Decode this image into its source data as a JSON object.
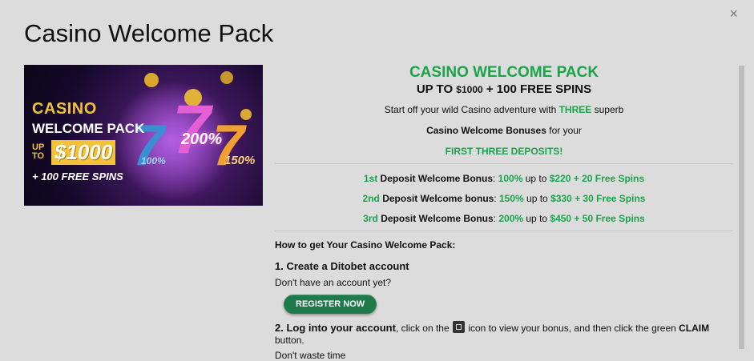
{
  "modal": {
    "title": "Casino Welcome Pack",
    "close_label": "×"
  },
  "banner": {
    "line1": "CASINO",
    "line2": "WELCOME PACK",
    "upto": "UP TO",
    "amount": "$1000",
    "spins": "+ 100 FREE SPINS",
    "pct_left": "100%",
    "pct_mid": "200%",
    "pct_right": "150%"
  },
  "content": {
    "heading": "CASINO WELCOME PACK",
    "sub_prefix": "UP TO ",
    "sub_amount": "$1000",
    "sub_suffix": " + 100 FREE SPINS",
    "intro_a": "Start off your wild Casino adventure with ",
    "intro_three": "THREE",
    "intro_b": " superb",
    "intro2_bold": "Casino Welcome Bonuses",
    "intro2_rest": " for your",
    "intro3": "FIRST THREE DEPOSITS",
    "intro3_end": "!",
    "deposits": [
      {
        "ord": "1st",
        "label": " Deposit Welcome Bonus",
        "sep": ": ",
        "pct": "100%",
        "mid": " up to ",
        "amount": "$220 + 20 Free Spins"
      },
      {
        "ord": "2nd",
        "label": " Deposit Welcome bonus",
        "sep": ": ",
        "pct": "150%",
        "mid": " up to ",
        "amount": "$330 + 30 Free Spins"
      },
      {
        "ord": "3rd",
        "label": " Deposit Welcome Bonus",
        "sep": ": ",
        "pct": "200%",
        "mid": " up to ",
        "amount": "$450 + 50 Free Spins"
      }
    ],
    "howto": "How to get Your Casino Welcome Pack:",
    "step1": "1. Create a Ditobet account",
    "step1_note": "Don't have an account yet?",
    "register_label": "REGISTER NOW",
    "step2_bold": "2. Log into your account",
    "step2_a": ", click on the ",
    "step2_b": " icon to view your bonus, and then click the green ",
    "step2_claim": "CLAIM",
    "step2_c": " button.",
    "step2_note": "Don't waste time"
  },
  "colors": {
    "accent_green": "#19a44a",
    "button_green": "#1e7a4a",
    "background": "#dcdcdc"
  }
}
